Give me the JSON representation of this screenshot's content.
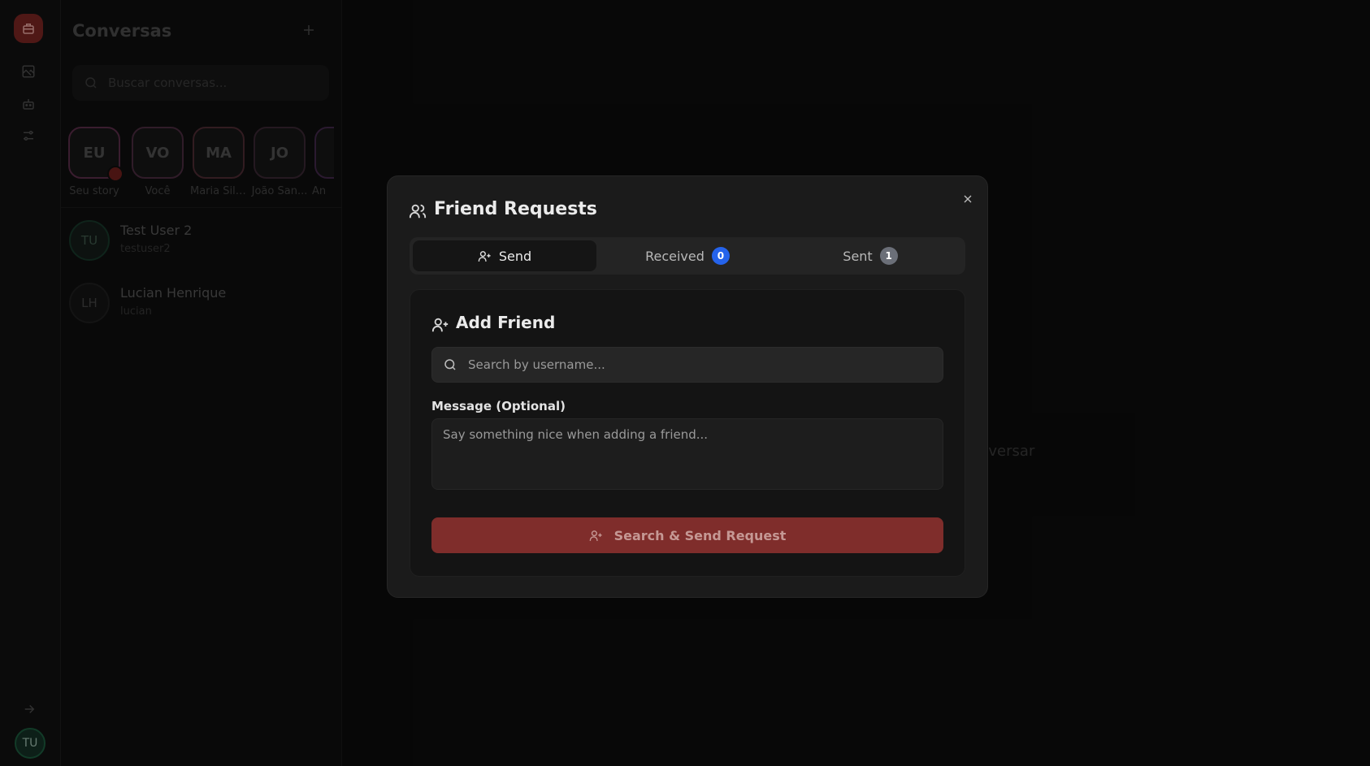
{
  "sidebar": {
    "profile_initials": "TU"
  },
  "conversations": {
    "title": "Conversas",
    "search_placeholder": "Buscar conversas...",
    "stories": [
      {
        "initials": "EU",
        "label": "Seu story"
      },
      {
        "initials": "VO",
        "label": "Você"
      },
      {
        "initials": "MA",
        "label": "Maria Silv..."
      },
      {
        "initials": "JO",
        "label": "João San..."
      },
      {
        "initials": "",
        "label": "An"
      }
    ],
    "contacts": [
      {
        "initials": "TU",
        "name": "Test User 2",
        "handle": "testuser2"
      },
      {
        "initials": "LH",
        "name": "Lucian Henrique",
        "handle": "lucian"
      }
    ]
  },
  "main": {
    "hint_fragment": "nversar"
  },
  "modal": {
    "title": "Friend Requests",
    "tabs": [
      {
        "label": "Send"
      },
      {
        "label": "Received",
        "count": "0"
      },
      {
        "label": "Sent",
        "count": "1"
      }
    ],
    "add_friend": {
      "title": "Add Friend",
      "search_placeholder": "Search by username...",
      "message_label": "Message (Optional)",
      "message_placeholder": "Say something nice when adding a friend...",
      "submit_label": "Search & Send Request"
    }
  },
  "colors": {
    "accent_red": "#7f2d2b",
    "badge_blue": "#2563eb",
    "badge_gray": "#6b6f78"
  }
}
